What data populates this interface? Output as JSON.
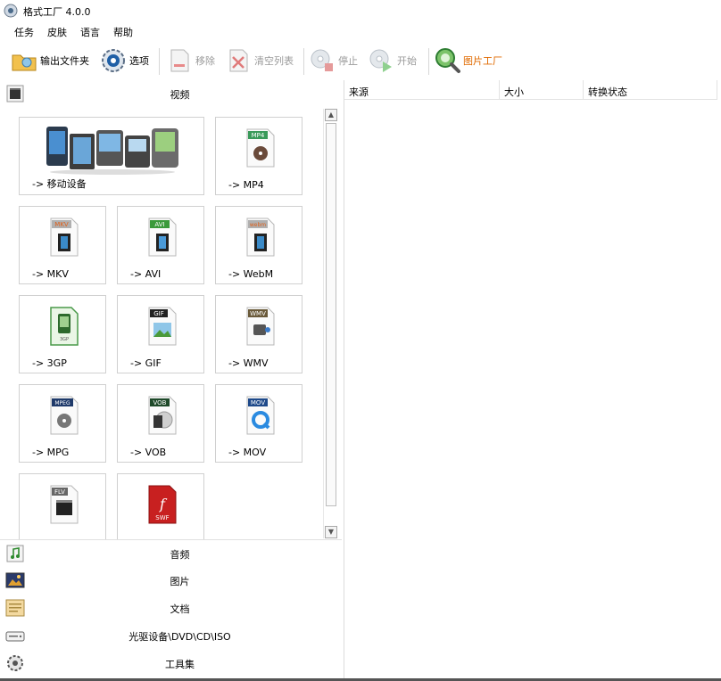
{
  "window": {
    "title": "格式工厂 4.0.0"
  },
  "menu": [
    "任务",
    "皮肤",
    "语言",
    "帮助"
  ],
  "toolbar": {
    "output_folder": "输出文件夹",
    "options": "选项",
    "remove": "移除",
    "clear_list": "清空列表",
    "stop": "停止",
    "start": "开始",
    "picture_factory": "图片工厂"
  },
  "sidebar": {
    "video": "视频",
    "audio": "音频",
    "picture": "图片",
    "document": "文档",
    "rom": "光驱设备\\DVD\\CD\\ISO",
    "tools": "工具集"
  },
  "video_formats": [
    {
      "label": "-> 移动设备",
      "badge": ""
    },
    {
      "label": "-> MP4",
      "badge": "MP4"
    },
    {
      "label": "-> MKV",
      "badge": "MKV"
    },
    {
      "label": "-> AVI",
      "badge": "AVI"
    },
    {
      "label": "-> WebM",
      "badge": "webm"
    },
    {
      "label": "-> 3GP",
      "badge": "3GP"
    },
    {
      "label": "-> GIF",
      "badge": "GIF"
    },
    {
      "label": "-> WMV",
      "badge": "WMV"
    },
    {
      "label": "-> MPG",
      "badge": "MPEG"
    },
    {
      "label": "-> VOB",
      "badge": "VOB"
    },
    {
      "label": "-> MOV",
      "badge": "MOV"
    },
    {
      "label": "",
      "badge": "FLV"
    },
    {
      "label": "",
      "badge": "SWF"
    }
  ],
  "task_table": {
    "columns": [
      "来源",
      "大小",
      "转换状态"
    ]
  },
  "colors": {
    "accent_orange": "#e06a00",
    "disabled_gray": "#9a9a9a"
  }
}
